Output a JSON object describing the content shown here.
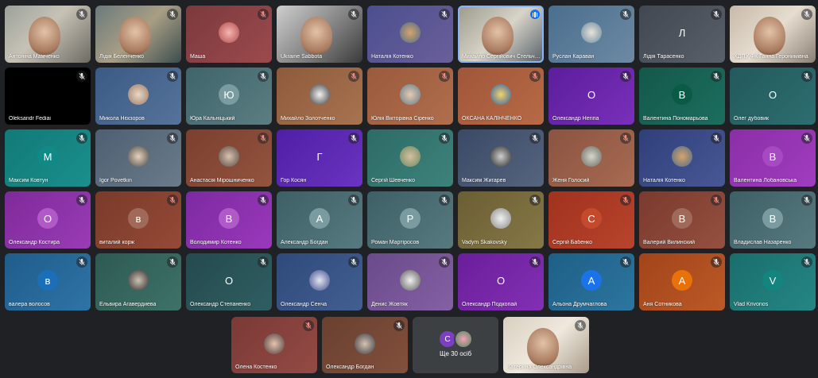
{
  "tiles": [
    {
      "name": "Антоніна Мамченко",
      "type": "video",
      "bg": "linear-gradient(135deg,#9aa29a,#c8c2b6 45%,#6d6b63)",
      "mic": "muted-dark"
    },
    {
      "name": "Лідія Беленченко",
      "type": "video",
      "bg": "linear-gradient(135deg,#6a7a7c,#a89e84 50%,#3d4d4f)",
      "mic": "muted-dark"
    },
    {
      "name": "Маша",
      "type": "photo",
      "bg": "linear-gradient(135deg,#7b3a3e,#9c4a4c)",
      "avatarBg": "radial-gradient(circle,#f3b6b0,#b24a4e)",
      "mic": "muted-red"
    },
    {
      "name": "Ukraine Sabbota",
      "type": "video",
      "bg": "linear-gradient(135deg,#cfcfcf,#7a7a7a 60%,#3a3a3a)",
      "mic": "muted-dark"
    },
    {
      "name": "Наталія Котенко",
      "type": "photo",
      "bg": "linear-gradient(135deg,#4b4f8e,#6a5f9a)",
      "avatarBg": "radial-gradient(circle,#d9a46a,#4b6b8c)",
      "mic": "muted-dark"
    },
    {
      "name": "Михайло Сергійович Стельченко",
      "type": "video",
      "bg": "linear-gradient(135deg,#9a9a8a,#d8d4c8 50%,#55606a)",
      "mic": "speaking",
      "highlight": true
    },
    {
      "name": "Руслан Караван",
      "type": "photo",
      "bg": "linear-gradient(135deg,#4a6e8e,#6d8aa3)",
      "avatarBg": "radial-gradient(circle,#e8e4d8,#6a8aa0)",
      "mic": "muted-dark"
    },
    {
      "name": "Лідія Тарасенко",
      "type": "letter",
      "letter": "Л",
      "bg": "linear-gradient(135deg,#424852,#5a6069)",
      "mic": "muted-dark"
    },
    {
      "name": "ХДПУ ФК Ганна Геронимівна",
      "type": "video",
      "bg": "linear-gradient(135deg,#c7b9a8,#e6ddd0 50%,#8a7f72)",
      "mic": "muted-dark"
    },
    {
      "name": "Oleksandr Fediai",
      "type": "black",
      "bg": "#000000",
      "mic": "muted-dark"
    },
    {
      "name": "Микола Нєкзоров",
      "type": "photo",
      "bg": "linear-gradient(135deg,#3b5a84,#56749a)",
      "avatarBg": "radial-gradient(circle,#ead8c8,#9a7a64)",
      "mic": "muted-dark"
    },
    {
      "name": "Юра Кальніцький",
      "type": "letter",
      "letter": "Ю",
      "bg": "linear-gradient(135deg,#3f646a,#5a7e82)",
      "avatarBg": "#7a9ca0",
      "mic": "muted-dark"
    },
    {
      "name": "Михайло Золотченко",
      "type": "photo",
      "bg": "linear-gradient(135deg,#8d5a3c,#a8734f)",
      "avatarBg": "radial-gradient(circle,#f2f2f2,#3a3a3a)",
      "mic": "muted-red"
    },
    {
      "name": "Юлія Вікторівна Сіренко",
      "type": "photo",
      "bg": "linear-gradient(135deg,#9a5a3c,#b06e4d)",
      "avatarBg": "radial-gradient(circle,#e9c8b2,#5f7d8a)",
      "mic": "muted-red"
    },
    {
      "name": "ОКСАНА КАЛІНЧЕНКО",
      "type": "photo",
      "bg": "linear-gradient(135deg,#a0563a,#b86a45)",
      "avatarBg": "radial-gradient(circle,#f6d26a,#2c5fa8)",
      "mic": "muted-red"
    },
    {
      "name": "Олександр Негіпа",
      "type": "letter",
      "letter": "О",
      "bg": "linear-gradient(135deg,#5b1e9c,#7a2fba)",
      "mic": "muted-dark"
    },
    {
      "name": "Валентина Пономарьова",
      "type": "letter",
      "letter": "В",
      "bg": "linear-gradient(135deg,#13584b,#1c6e5e)",
      "avatarBg": "#0b5a46",
      "mic": "muted-dark"
    },
    {
      "name": "Олег дубовик",
      "type": "letter",
      "letter": "О",
      "bg": "linear-gradient(135deg,#22595c,#2d6e70)",
      "mic": "muted-dark"
    },
    {
      "name": "Максим Ковтун",
      "type": "letter",
      "letter": "М",
      "bg": "linear-gradient(135deg,#127a78,#1a8f8c)",
      "avatarBg": "#0f8a86",
      "mic": "muted-dark"
    },
    {
      "name": "Igor Povetkin",
      "type": "photo",
      "bg": "linear-gradient(135deg,#4e5f72,#6a7b8a)",
      "avatarBg": "radial-gradient(circle,#e7d2bc,#4a4a4a)",
      "mic": "muted-dark"
    },
    {
      "name": "Анастасія Мірошниченко",
      "type": "photo",
      "bg": "linear-gradient(135deg,#7a3f2f,#94543e)",
      "avatarBg": "radial-gradient(circle,#d9c2b0,#5a4a42)",
      "mic": "muted-red"
    },
    {
      "name": "Гор Косян",
      "type": "letter",
      "letter": "Г",
      "bg": "linear-gradient(135deg,#4f1fa6,#6a34c0)",
      "mic": "muted-dark"
    },
    {
      "name": "Сергій Шевченко",
      "type": "photo",
      "bg": "linear-gradient(135deg,#2d6b66,#3e827c)",
      "avatarBg": "radial-gradient(circle,#d6c0a2,#6a8a60)",
      "mic": "muted-dark"
    },
    {
      "name": "Максим Жигарев",
      "type": "photo",
      "bg": "linear-gradient(135deg,#3a4a66,#55657e)",
      "avatarBg": "radial-gradient(circle,#cfcfcf,#2a2a2a)",
      "mic": "muted-dark"
    },
    {
      "name": "Женя Голосий",
      "type": "photo",
      "bg": "linear-gradient(135deg,#8a5440,#a86a52)",
      "avatarBg": "radial-gradient(circle,#d6d6cc,#6a6a60)",
      "mic": "muted-red"
    },
    {
      "name": "Наталія Котенко",
      "type": "photo",
      "bg": "linear-gradient(135deg,#2e3f7a,#485896)",
      "avatarBg": "radial-gradient(circle,#d9a46a,#4b6b8c)",
      "mic": "muted-dark"
    },
    {
      "name": "Валентина Лобановська",
      "type": "letter",
      "letter": "В",
      "bg": "linear-gradient(135deg,#8a2fa6,#a13cc0)",
      "avatarBg": "#a54ac0",
      "mic": "muted-dark"
    },
    {
      "name": "Олександр Костира",
      "type": "letter",
      "letter": "О",
      "bg": "linear-gradient(135deg,#7e2a9a,#9a3cb6)",
      "avatarBg": "#b05ac8",
      "mic": "muted-dark"
    },
    {
      "name": "виталий корж",
      "type": "letter",
      "letter": "в",
      "bg": "linear-gradient(135deg,#7a3a2a,#954a36)",
      "avatarBg": "#a06a5a",
      "mic": "muted-red"
    },
    {
      "name": "Володимир Котенко",
      "type": "letter",
      "letter": "В",
      "bg": "linear-gradient(135deg,#7c2aa0,#9a38bc)",
      "avatarBg": "#b05ac8",
      "mic": "muted-dark"
    },
    {
      "name": "Александр Богдан",
      "type": "letter",
      "letter": "А",
      "bg": "linear-gradient(135deg,#3d6066,#577a80)",
      "avatarBg": "#7a9ca0",
      "mic": "muted-dark"
    },
    {
      "name": "Роман Мартіросов",
      "type": "letter",
      "letter": "Р",
      "bg": "linear-gradient(135deg,#3d6066,#577a80)",
      "avatarBg": "#7a9ca0",
      "mic": "muted-dark"
    },
    {
      "name": "Vadym Skakovsky",
      "type": "photo",
      "bg": "linear-gradient(135deg,#6a5e34,#867846)",
      "avatarBg": "radial-gradient(circle,#f0f0f0,#8a8a8a)",
      "mic": "muted-dark"
    },
    {
      "name": "Сергій Бабенко",
      "type": "letter",
      "letter": "С",
      "bg": "linear-gradient(135deg,#a0321e,#b8442c)",
      "avatarBg": "#c44a2e",
      "mic": "muted-red"
    },
    {
      "name": "Валерий Вилинский",
      "type": "letter",
      "letter": "В",
      "bg": "linear-gradient(135deg,#7a3a2e,#955040)",
      "avatarBg": "#a06a5a",
      "mic": "muted-red"
    },
    {
      "name": "Владислав Назаренко",
      "type": "letter",
      "letter": "В",
      "bg": "linear-gradient(135deg,#3d6066,#577a80)",
      "avatarBg": "#7a9ca0",
      "mic": "muted-dark"
    },
    {
      "name": "валера волосов",
      "type": "letter",
      "letter": "в",
      "bg": "linear-gradient(135deg,#1f5c8a,#2e74a6)",
      "avatarBg": "#1a6fb8",
      "mic": "muted-dark"
    },
    {
      "name": "Ельвира Агавердиева",
      "type": "photo",
      "bg": "linear-gradient(135deg,#2d5a52,#3e7268)",
      "avatarBg": "radial-gradient(circle,#cfc2b4,#2a2a2a)",
      "mic": "muted-dark"
    },
    {
      "name": "Олександр Степаненко",
      "type": "letter",
      "letter": "О",
      "bg": "linear-gradient(135deg,#244a4e,#2f5e62)",
      "mic": "muted-dark"
    },
    {
      "name": "Олександр Сенча",
      "type": "photo",
      "bg": "linear-gradient(135deg,#2e4a7a,#435f92)",
      "avatarBg": "radial-gradient(circle,#e6e6f0,#3a4a8a)",
      "mic": "muted-dark"
    },
    {
      "name": "Денис Жовтяк",
      "type": "photo",
      "bg": "linear-gradient(135deg,#6a4a8a,#8460a4)",
      "avatarBg": "radial-gradient(circle,#f0f0f0,#5a5a5a)",
      "mic": "muted-dark"
    },
    {
      "name": "Олександр Подкопай",
      "type": "letter",
      "letter": "О",
      "bg": "linear-gradient(135deg,#6a1e9a,#8230b4)",
      "mic": "muted-dark"
    },
    {
      "name": "Альона Друмчаглова",
      "type": "letter",
      "letter": "А",
      "bg": "linear-gradient(135deg,#1e5f86,#2c76a0)",
      "avatarBg": "#1a73e8",
      "mic": "muted-dark"
    },
    {
      "name": "Аня Сотникова",
      "type": "letter",
      "letter": "А",
      "bg": "linear-gradient(135deg,#a2441a,#bc5a26)",
      "avatarBg": "#e8710a",
      "mic": "muted-dark"
    },
    {
      "name": "Vlad Krivonos",
      "type": "letter",
      "letter": "V",
      "bg": "linear-gradient(135deg,#1a6e6c,#248684)",
      "avatarBg": "#12857f",
      "mic": "muted-dark"
    }
  ],
  "bottom": [
    {
      "name": "Олена Костенко",
      "type": "photo",
      "bg": "linear-gradient(135deg,#7a3a36,#944a44)",
      "avatarBg": "radial-gradient(circle,#e6c4b0,#4a3a3a)",
      "mic": "muted-red"
    },
    {
      "name": "Олександр Богдан",
      "type": "photo",
      "bg": "linear-gradient(135deg,#6a4030,#82503c)",
      "avatarBg": "radial-gradient(circle,#d6c2b0,#3a3a44)",
      "mic": "muted-dark"
    },
    {
      "name": "Ще 30 осіб",
      "type": "more",
      "bg": "#3c4043",
      "letter1": "С",
      "letter2": "",
      "avatar1": "#7b3fbf",
      "avatar2": "radial-gradient(circle,#f4a0b8,#4a8a5a)"
    },
    {
      "name": "Катерина Олександрівна",
      "type": "video",
      "bg": "linear-gradient(135deg,#d8cfc0,#efe8dc 50%,#a89c8a)",
      "mic": "muted-dark"
    }
  ]
}
